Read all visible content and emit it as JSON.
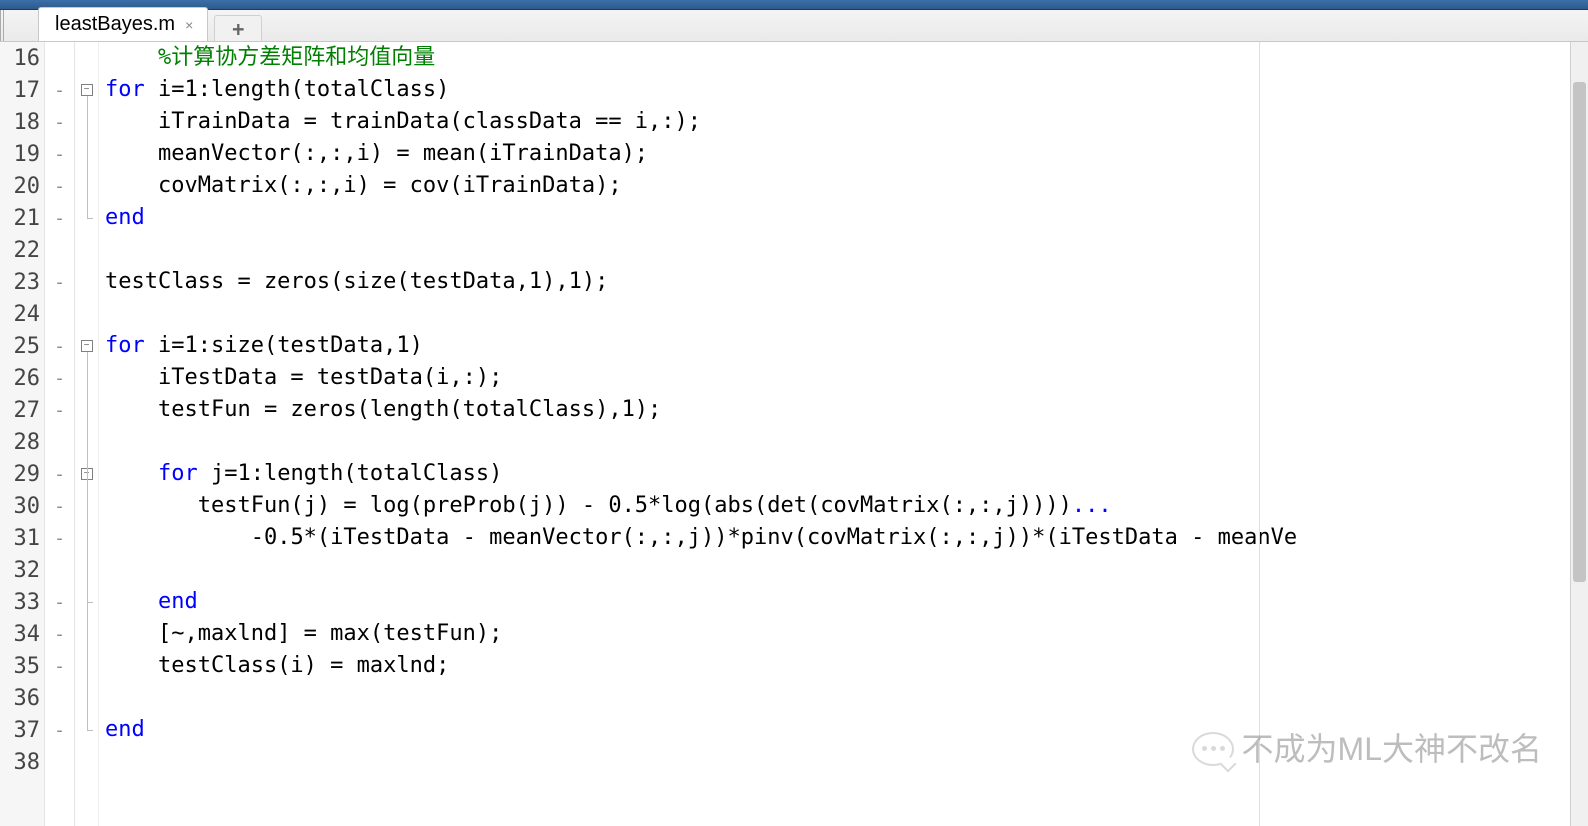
{
  "tab": {
    "filename": "leastBayes.m",
    "close": "×",
    "newtab": "+"
  },
  "gutter": [
    "16",
    "17",
    "18",
    "19",
    "20",
    "21",
    "22",
    "23",
    "24",
    "25",
    "26",
    "27",
    "28",
    "29",
    "30",
    "31",
    "32",
    "33",
    "34",
    "35",
    "36",
    "37",
    "38"
  ],
  "breaks": [
    "",
    "-",
    "-",
    "-",
    "-",
    "-",
    "",
    "-",
    "",
    "-",
    "-",
    "-",
    "",
    "-",
    "-",
    "-",
    "",
    "-",
    "-",
    "-",
    "",
    "-",
    ""
  ],
  "fold": [
    "",
    "open",
    "",
    "",
    "",
    "close",
    "",
    "",
    "",
    "open",
    "",
    "",
    "",
    "open",
    "",
    "",
    "",
    "close",
    "",
    "",
    "",
    "close",
    ""
  ],
  "watermark": "不成为ML大神不改名",
  "code": [
    {
      "indent": "    ",
      "segs": [
        {
          "t": "%计算协方差矩阵和均值向量",
          "c": "cm"
        }
      ]
    },
    {
      "indent": "",
      "segs": [
        {
          "t": "for",
          "c": "kw"
        },
        {
          "t": " i=1:length(totalClass)"
        }
      ]
    },
    {
      "indent": "    ",
      "segs": [
        {
          "t": "iTrainData = trainData(classData == i,:);"
        }
      ]
    },
    {
      "indent": "    ",
      "segs": [
        {
          "t": "meanVector(:,:,i) = mean(iTrainData);"
        }
      ]
    },
    {
      "indent": "    ",
      "segs": [
        {
          "t": "covMatrix(:,:,i) = cov(iTrainData);"
        }
      ]
    },
    {
      "indent": "",
      "segs": [
        {
          "t": "end",
          "c": "kw"
        }
      ]
    },
    {
      "indent": "",
      "segs": []
    },
    {
      "indent": "",
      "segs": [
        {
          "t": "testClass = zeros(size(testData,1),1);"
        }
      ]
    },
    {
      "indent": "",
      "segs": []
    },
    {
      "indent": "",
      "segs": [
        {
          "t": "for",
          "c": "kw"
        },
        {
          "t": " i=1:size(testData,1)"
        }
      ]
    },
    {
      "indent": "    ",
      "segs": [
        {
          "t": "iTestData = testData(i,:);"
        }
      ]
    },
    {
      "indent": "    ",
      "segs": [
        {
          "t": "testFun = zeros(length(totalClass),1);"
        }
      ]
    },
    {
      "indent": "",
      "segs": []
    },
    {
      "indent": "    ",
      "segs": [
        {
          "t": "for",
          "c": "kw"
        },
        {
          "t": " j=1:length(totalClass)"
        }
      ]
    },
    {
      "indent": "       ",
      "segs": [
        {
          "t": "testFun(j) = log(preProb(j)) - 0.5*log(abs(det(covMatrix(:,:,j))))"
        },
        {
          "t": "...",
          "c": "dots"
        }
      ]
    },
    {
      "indent": "           ",
      "segs": [
        {
          "t": "-0.5*(iTestData - meanVector(:,:,j))*pinv(covMatrix(:,:,j))*(iTestData - meanVe"
        }
      ]
    },
    {
      "indent": "",
      "segs": []
    },
    {
      "indent": "    ",
      "segs": [
        {
          "t": "end",
          "c": "kw"
        }
      ]
    },
    {
      "indent": "    ",
      "segs": [
        {
          "t": "[~,maxlnd] = max(testFun);"
        }
      ]
    },
    {
      "indent": "    ",
      "segs": [
        {
          "t": "testClass(i) = maxlnd;"
        }
      ]
    },
    {
      "indent": "",
      "segs": []
    },
    {
      "indent": "",
      "segs": [
        {
          "t": "end",
          "c": "kw"
        }
      ]
    },
    {
      "indent": "",
      "segs": []
    }
  ]
}
